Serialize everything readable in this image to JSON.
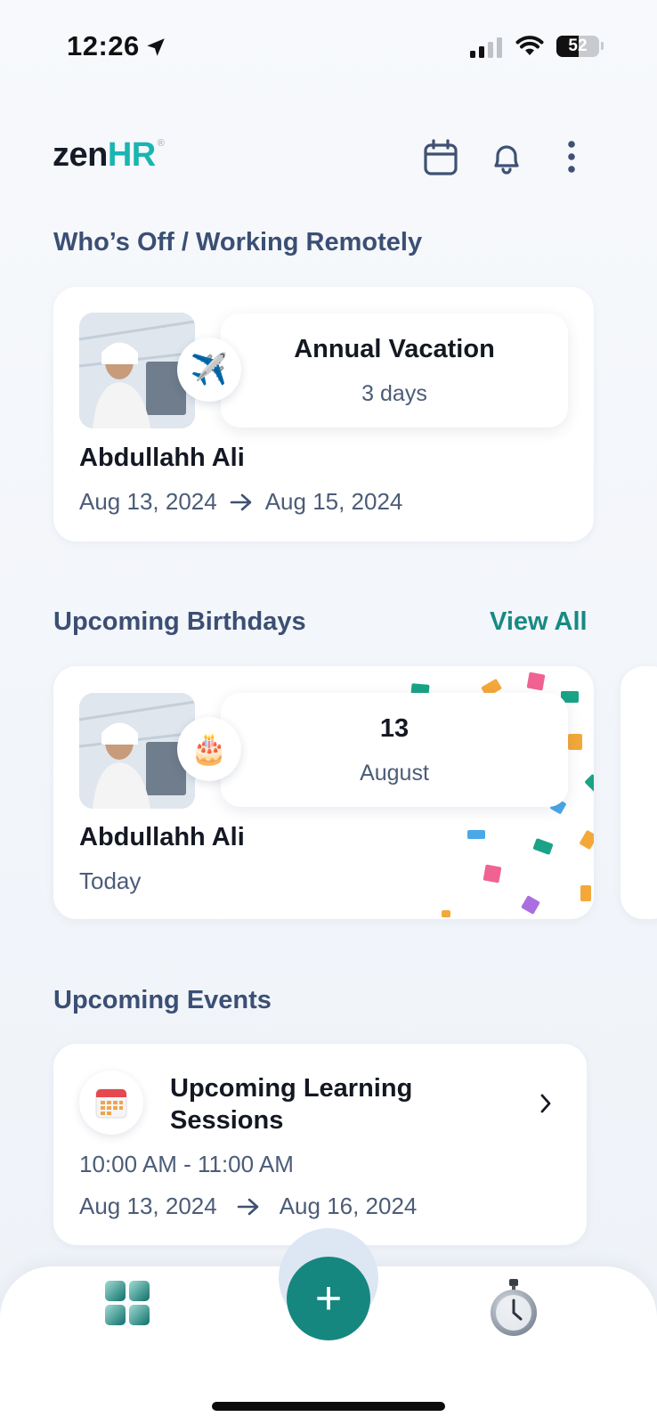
{
  "status_bar": {
    "time": "12:26",
    "battery": "52",
    "battery_level": 0.52
  },
  "header": {
    "logo_zen": "zen",
    "logo_hr": "HR",
    "logo_reg": "®",
    "icons": [
      "calendar-icon",
      "bell-icon",
      "more-vertical-icon"
    ]
  },
  "whos_off": {
    "title": "Who’s Off / Working Remotely",
    "card": {
      "leave_type": "Annual Vacation",
      "duration": "3 days",
      "badge_icon": "✈️",
      "name": "Abdullahh Ali",
      "start_date": "Aug 13, 2024",
      "end_date": "Aug 15, 2024"
    }
  },
  "birthdays": {
    "title": "Upcoming Birthdays",
    "view_all": "View All",
    "card": {
      "day": "13",
      "month": "August",
      "badge_icon": "🎂",
      "name": "Abdullahh Ali",
      "when": "Today"
    }
  },
  "events": {
    "title": "Upcoming Events",
    "card": {
      "title": "Upcoming Learning Sessions",
      "time": "10:00 AM - 11:00 AM",
      "start_date": "Aug 13, 2024",
      "end_date": "Aug 16, 2024"
    }
  },
  "bottom_nav": {
    "fab_label": "+",
    "items": [
      "dashboard-icon",
      "stopwatch-icon"
    ]
  },
  "colors": {
    "accent": "#16877f",
    "brand_teal": "#19b5b0",
    "section_title": "#3b4f74"
  }
}
